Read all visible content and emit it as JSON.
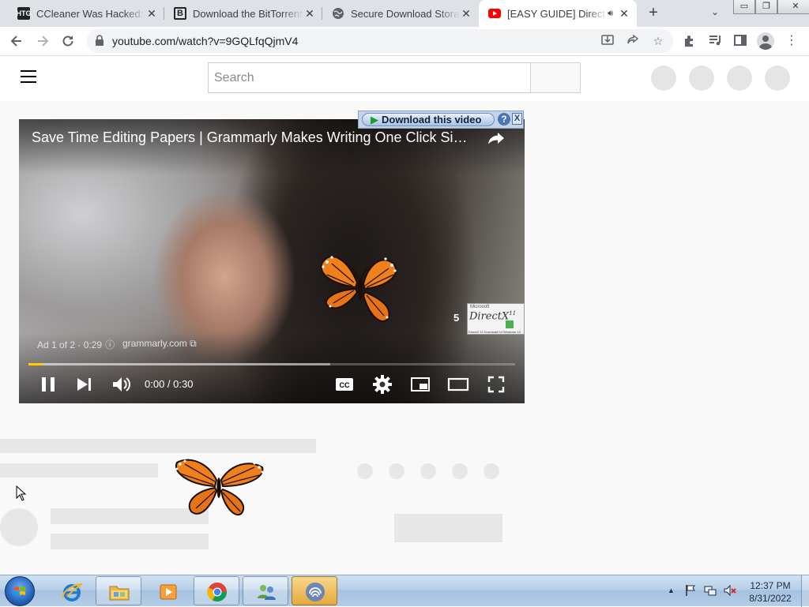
{
  "browser": {
    "tabs": [
      {
        "title": "CCleaner Was Hacked: What You Need to Know",
        "favicon": "htg-icon",
        "favicon_text": "HTG"
      },
      {
        "title": "Download the BitTorrent Web",
        "favicon": "b-icon",
        "favicon_text": "B"
      },
      {
        "title": "Secure Download Storage",
        "favicon": "globe-icon"
      },
      {
        "title": "[EASY GUIDE] DirectX",
        "favicon": "youtube-icon",
        "active": true,
        "audio": true
      }
    ],
    "address": "youtube.com/watch?v=9GQLfqQjmV4"
  },
  "youtube": {
    "search_placeholder": "Search"
  },
  "download_overlay": {
    "button_label": "Download this video",
    "help_label": "?",
    "close_label": "X"
  },
  "player": {
    "title": "Save Time Editing Papers | Grammarly Makes Writing One Click Simp...",
    "ad_label": "Ad 1 of 2 · 0:29",
    "ad_domain": "grammarly.com",
    "skip_countdown": "5",
    "thumbnail": {
      "brand": "Microsoft",
      "text": "DirectX",
      "version": "11",
      "caption": "DirectX 11 Download for Windows 10"
    },
    "time": "0:00 / 0:30",
    "progress_played": 0.03,
    "progress_buffered": 0.62,
    "accent_color": "#ffcc00"
  },
  "taskbar": {
    "apps": [
      "internet-explorer",
      "windows-explorer",
      "media-player",
      "chrome",
      "users",
      "bittorrent"
    ],
    "active_app": "bittorrent",
    "clock_time": "12:37 PM",
    "clock_date": "8/31/2022"
  }
}
